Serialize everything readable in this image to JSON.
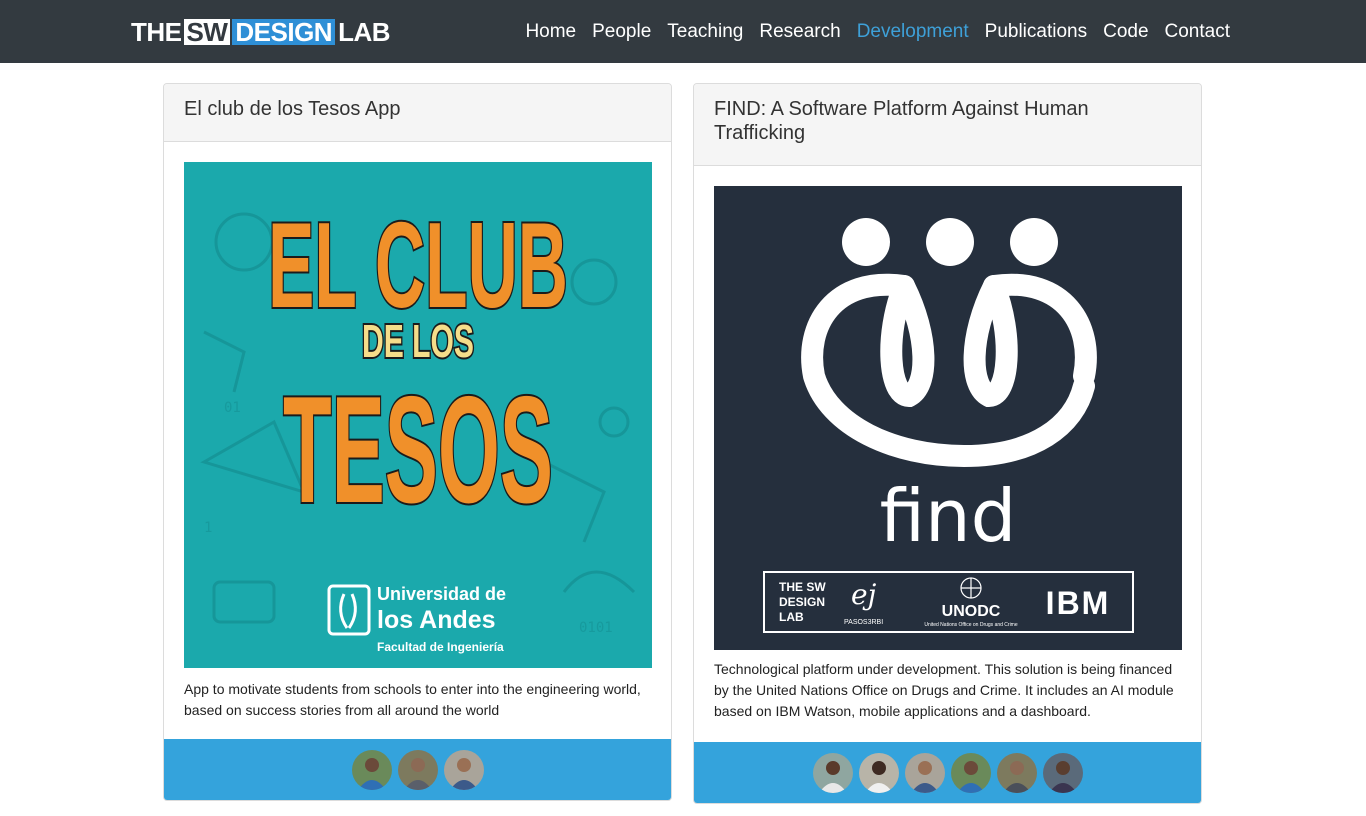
{
  "brand": {
    "part1": "THE",
    "part2": "SW",
    "part3": "DESIGN",
    "part4": "LAB"
  },
  "nav": {
    "items": [
      {
        "label": "Home"
      },
      {
        "label": "People"
      },
      {
        "label": "Teaching"
      },
      {
        "label": "Research"
      },
      {
        "label": "Development"
      },
      {
        "label": "Publications"
      },
      {
        "label": "Code"
      },
      {
        "label": "Contact"
      }
    ],
    "active": "Development",
    "active_color": "#3ea0d8"
  },
  "projects": [
    {
      "title": "El club de los Tesos App",
      "image": {
        "line1": "EL CLUB",
        "line2": "DE LOS",
        "line3": "TESOS",
        "uni_line1": "Universidad de",
        "uni_line2": "los Andes",
        "uni_line3": "Facultad de Ingeniería"
      },
      "description": "App to motivate students from schools to enter into the engineering world, based on success stories from all around the world",
      "member_count": 3
    },
    {
      "title": "FIND: A Software Platform Against Human Trafficking",
      "image": {
        "word": "find",
        "logo_lab_1": "THE SW",
        "logo_lab_2": "DESIGN",
        "logo_lab_3": "LAB",
        "logo_ej": "PASOS3RBI",
        "logo_unodc": "UNODC",
        "logo_unodc_sub": "United Nations Office on Drugs and Crime",
        "logo_ibm": "IBM"
      },
      "description": "Technological platform under development. This solution is being financed by the United Nations Office on Drugs and Crime. It includes an AI module based on IBM Watson, mobile applications and a dashboard.",
      "member_count": 6
    }
  ],
  "colors": {
    "navbar": "#333a40",
    "footer": "#34a3dc",
    "tesos_bg": "#1ba9ac",
    "find_bg": "#252f3d",
    "orange": "#f0902a"
  }
}
